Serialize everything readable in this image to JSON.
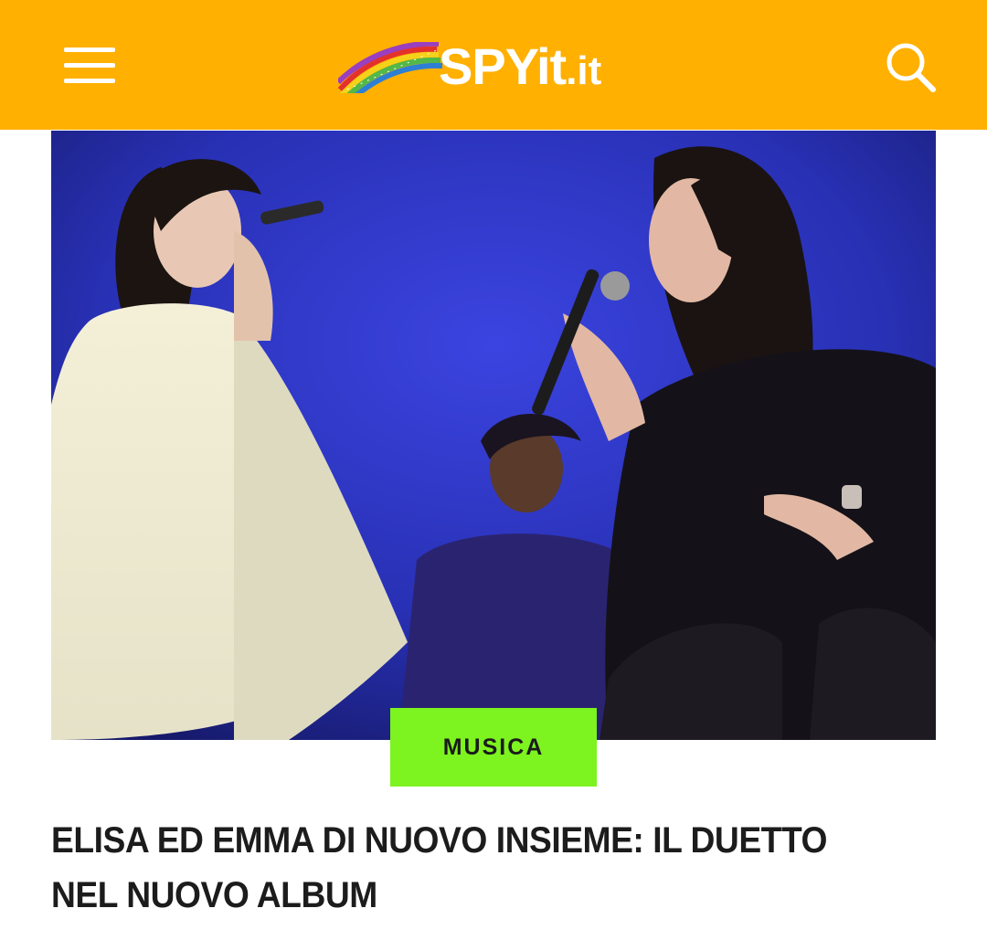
{
  "header": {
    "logo_text": "SPYit",
    "logo_tld": ".it",
    "background_color": "#ffb000",
    "menu_icon": "hamburger-menu-icon",
    "search_icon": "search-icon"
  },
  "article": {
    "image_description": "",
    "category": "MUSICA",
    "category_color": "#7df31f",
    "title": "ELISA ED EMMA DI NUOVO INSIEME: IL DUETTO NEL NUOVO ALBUM"
  }
}
